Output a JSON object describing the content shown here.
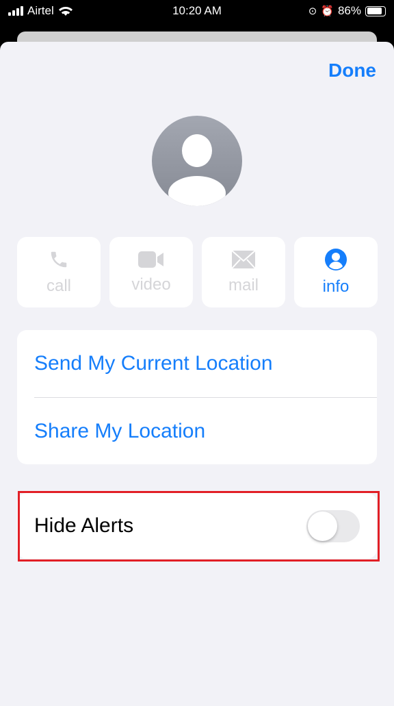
{
  "status_bar": {
    "carrier": "Airtel",
    "time": "10:20 AM",
    "battery": "86%",
    "battery_level": 0.86
  },
  "header": {
    "done_label": "Done"
  },
  "actions": [
    {
      "label": "call",
      "icon": "phone-icon",
      "enabled": false
    },
    {
      "label": "video",
      "icon": "video-camera-icon",
      "enabled": false
    },
    {
      "label": "mail",
      "icon": "envelope-icon",
      "enabled": false
    },
    {
      "label": "info",
      "icon": "person-circle-icon",
      "enabled": true
    }
  ],
  "location": {
    "send_current": "Send My Current Location",
    "share": "Share My Location"
  },
  "hide_alerts": {
    "label": "Hide Alerts",
    "on": false
  },
  "colors": {
    "accent": "#157efb",
    "highlight": "#e21f26",
    "disabled": "#d5d5d8"
  }
}
